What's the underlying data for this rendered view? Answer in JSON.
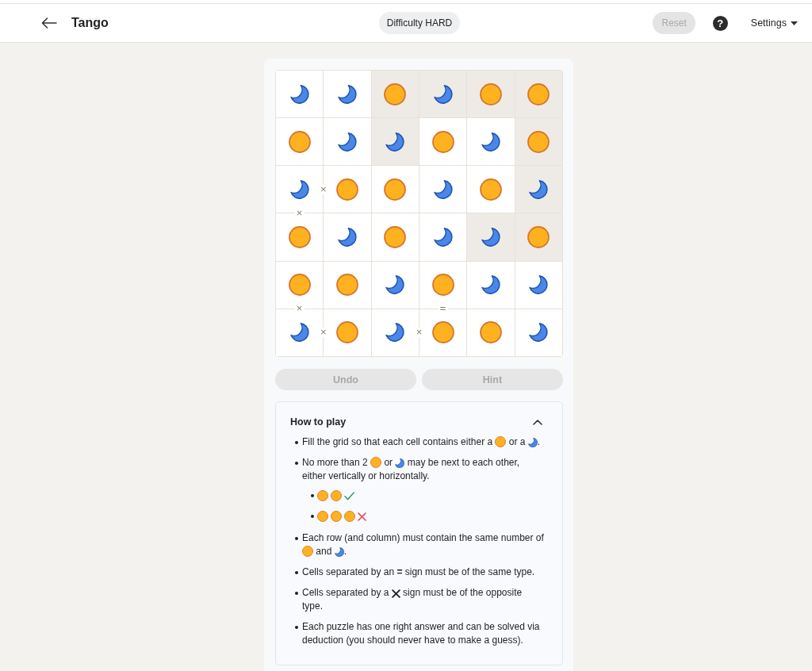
{
  "header": {
    "title": "Tango",
    "difficulty": "Difficulty HARD",
    "reset": {
      "label": "Reset",
      "disabled": true
    },
    "help": "?",
    "settings": "Settings"
  },
  "grid": {
    "rows": [
      [
        {
          "kind": "moon",
          "locked": false
        },
        {
          "kind": "moon",
          "locked": false
        },
        {
          "kind": "sun",
          "locked": true
        },
        {
          "kind": "moon",
          "locked": true
        },
        {
          "kind": "sun",
          "locked": true
        },
        {
          "kind": "sun",
          "locked": true
        }
      ],
      [
        {
          "kind": "sun",
          "locked": false
        },
        {
          "kind": "moon",
          "locked": false
        },
        {
          "kind": "moon",
          "locked": true
        },
        {
          "kind": "sun",
          "locked": false
        },
        {
          "kind": "moon",
          "locked": false
        },
        {
          "kind": "sun",
          "locked": true
        }
      ],
      [
        {
          "kind": "moon",
          "locked": false,
          "right": "×",
          "below": "×"
        },
        {
          "kind": "sun",
          "locked": false
        },
        {
          "kind": "sun",
          "locked": false
        },
        {
          "kind": "moon",
          "locked": false
        },
        {
          "kind": "sun",
          "locked": false
        },
        {
          "kind": "moon",
          "locked": true
        }
      ],
      [
        {
          "kind": "sun",
          "locked": false
        },
        {
          "kind": "moon",
          "locked": false
        },
        {
          "kind": "sun",
          "locked": false
        },
        {
          "kind": "moon",
          "locked": false
        },
        {
          "kind": "moon",
          "locked": true
        },
        {
          "kind": "sun",
          "locked": true
        }
      ],
      [
        {
          "kind": "sun",
          "locked": false,
          "below": "×"
        },
        {
          "kind": "sun",
          "locked": false
        },
        {
          "kind": "moon",
          "locked": false
        },
        {
          "kind": "sun",
          "locked": false,
          "below": "="
        },
        {
          "kind": "moon",
          "locked": false
        },
        {
          "kind": "moon",
          "locked": false
        }
      ],
      [
        {
          "kind": "moon",
          "locked": false,
          "right": "×"
        },
        {
          "kind": "sun",
          "locked": false
        },
        {
          "kind": "moon",
          "locked": false,
          "right": "×"
        },
        {
          "kind": "sun",
          "locked": false
        },
        {
          "kind": "sun",
          "locked": false
        },
        {
          "kind": "moon",
          "locked": false
        }
      ]
    ]
  },
  "controls": [
    {
      "label": "Undo",
      "disabled": true
    },
    {
      "label": "Hint",
      "disabled": true
    }
  ],
  "how_to_play": {
    "title": "How to play",
    "expanded": true,
    "rules": [
      {
        "lines": [
          [
            {
              "kind": "text",
              "text": "Fill the grid so that each cell contains either a "
            },
            {
              "kind": "sun"
            },
            {
              "kind": "text",
              "text": " or a "
            },
            {
              "kind": "moon"
            },
            {
              "kind": "text",
              "text": "."
            }
          ]
        ]
      },
      {
        "lines": [
          [
            {
              "kind": "text",
              "text": "No more than 2 "
            },
            {
              "kind": "sun"
            },
            {
              "kind": "text",
              "text": " or "
            },
            {
              "kind": "moon"
            },
            {
              "kind": "text",
              "text": " may be next to each other,"
            }
          ],
          [
            {
              "kind": "text",
              "text": "either vertically or horizontally."
            }
          ]
        ],
        "examples": [
          {
            "parts": [
              {
                "kind": "sun"
              },
              {
                "kind": "sun"
              }
            ],
            "valid": true
          },
          {
            "parts": [
              {
                "kind": "sun"
              },
              {
                "kind": "sun"
              },
              {
                "kind": "sun"
              }
            ],
            "valid": false
          }
        ]
      },
      {
        "lines": [
          [
            {
              "kind": "text",
              "text": "Each row (and column) must contain the same number of"
            }
          ],
          [
            {
              "kind": "sun"
            },
            {
              "kind": "text",
              "text": " and "
            },
            {
              "kind": "moon"
            },
            {
              "kind": "text",
              "text": "."
            }
          ]
        ]
      },
      {
        "lines": [
          [
            {
              "kind": "text",
              "text": "Cells separated by an **=** sign must be of the same type."
            }
          ]
        ]
      },
      {
        "lines": [
          [
            {
              "kind": "text",
              "text": "Cells separated by a "
            },
            {
              "kind": "cross"
            },
            {
              "kind": "text",
              "text": " sign must be of the opposite"
            }
          ],
          [
            {
              "kind": "text",
              "text": "type."
            }
          ]
        ]
      },
      {
        "lines": [
          [
            {
              "kind": "text",
              "text": "Each puzzle has one right answer and can be solved via deduction (you should never have to make a guess)."
            }
          ]
        ]
      }
    ]
  }
}
